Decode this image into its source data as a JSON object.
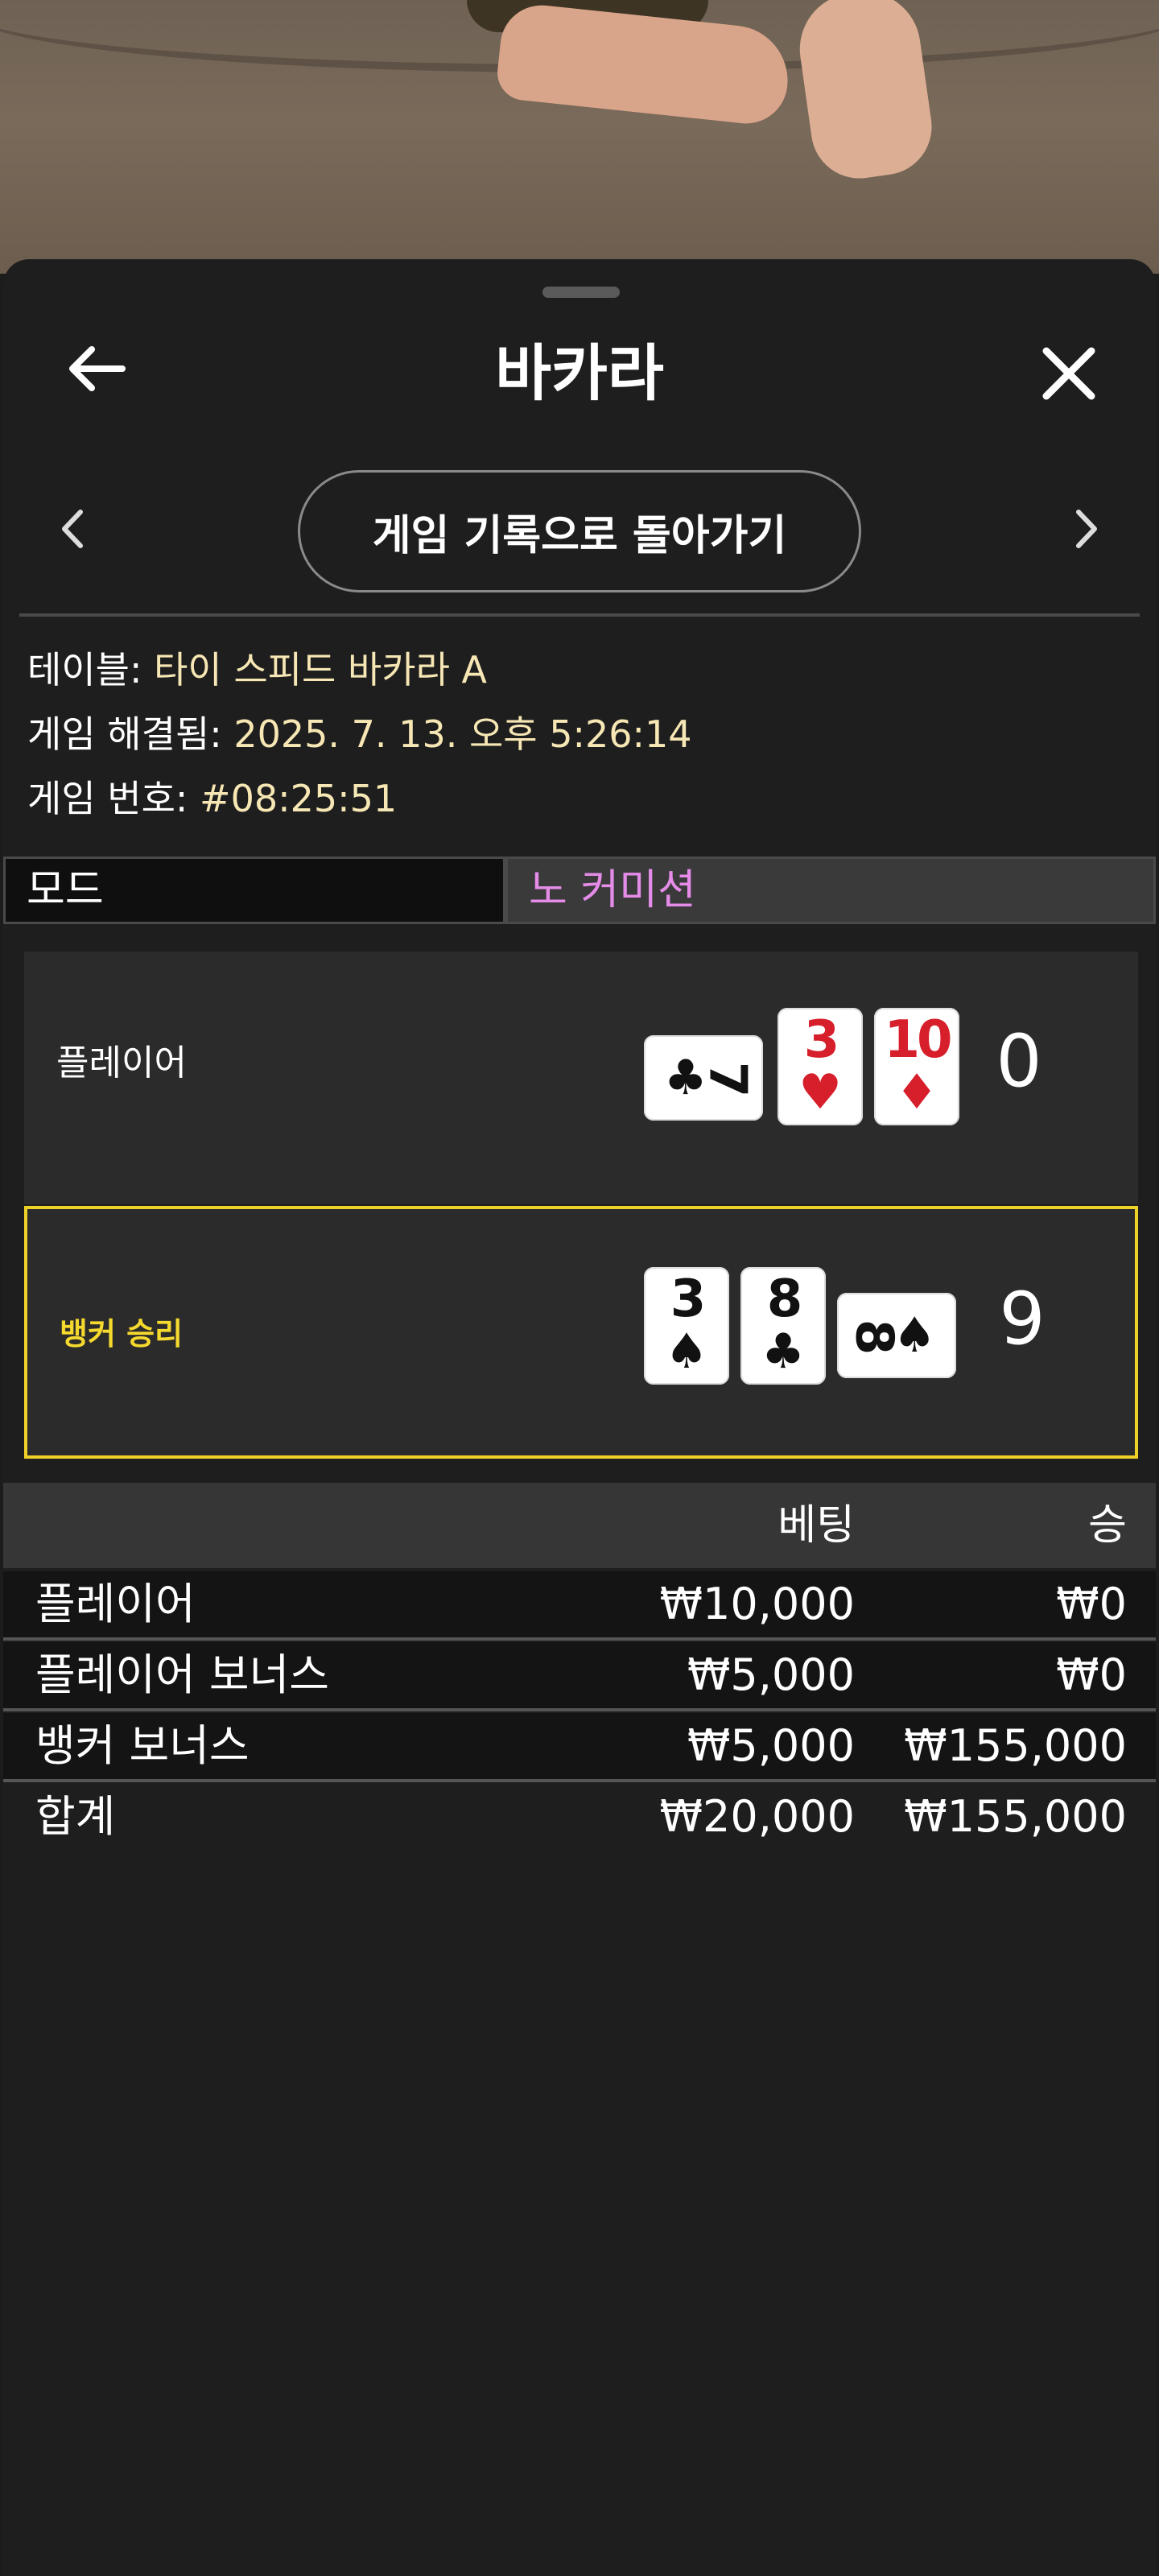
{
  "header": {
    "title": "바카라",
    "back_icon": "arrow-left-icon",
    "close_icon": "close-icon"
  },
  "nav": {
    "back_to_history_label": "게임 기록으로 돌아가기",
    "prev_icon": "chevron-left-icon",
    "next_icon": "chevron-right-icon"
  },
  "info": {
    "table_label": "테이블:",
    "table_value": "타이 스피드 바카라 A",
    "resolved_label": "게임 해결됨:",
    "resolved_value": "2025. 7. 13. 오후 5:26:14",
    "game_no_label": "게임 번호:",
    "game_no_value": "#08:25:51"
  },
  "mode": {
    "label": "모드",
    "value": "노 커미션"
  },
  "hands": {
    "player": {
      "label": "플레이어",
      "score": "0",
      "cards": [
        {
          "rank": "7",
          "suit": "♣",
          "color": "#111111",
          "orientation": "horizontal"
        },
        {
          "rank": "3",
          "suit": "♥",
          "color": "#d61f2b",
          "orientation": "vertical"
        },
        {
          "rank": "10",
          "suit": "♦",
          "color": "#d61f2b",
          "orientation": "vertical"
        }
      ]
    },
    "banker": {
      "label": "뱅커 승리",
      "score": "9",
      "cards": [
        {
          "rank": "3",
          "suit": "♠",
          "color": "#111111",
          "orientation": "vertical"
        },
        {
          "rank": "8",
          "suit": "♣",
          "color": "#111111",
          "orientation": "vertical"
        },
        {
          "rank": "8",
          "suit": "♠",
          "color": "#111111",
          "orientation": "horizontal"
        }
      ]
    }
  },
  "bets_table": {
    "headers": {
      "bet": "베팅",
      "win": "승"
    },
    "rows": [
      {
        "name": "플레이어",
        "bet": "₩10,000",
        "win": "₩0"
      },
      {
        "name": "플레이어 보너스",
        "bet": "₩5,000",
        "win": "₩0"
      },
      {
        "name": "뱅커 보너스",
        "bet": "₩5,000",
        "win": "₩155,000"
      }
    ],
    "total": {
      "name": "합계",
      "bet": "₩20,000",
      "win": "₩155,000"
    }
  },
  "colors": {
    "accent_yellow": "#f0d128",
    "info_value": "#f6e7b4",
    "mode_value": "#e48ce8",
    "red_suit": "#d61f2b"
  }
}
